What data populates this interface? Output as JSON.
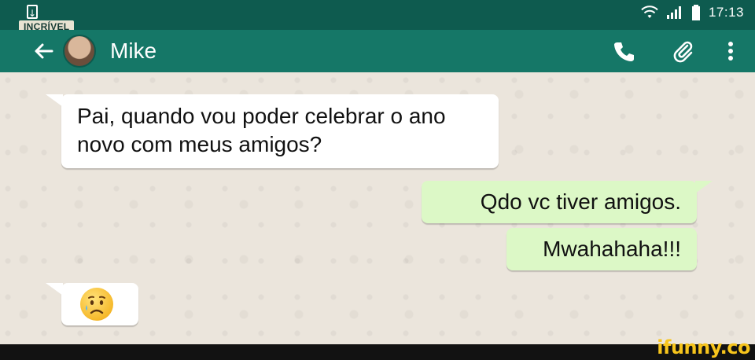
{
  "status_bar": {
    "time": "17:13",
    "brand_badge": "INCRÍVEL",
    "icons": [
      "download-icon",
      "wifi-icon",
      "signal-icon",
      "battery-icon"
    ]
  },
  "app_bar": {
    "contact_name": "Mike",
    "icons": [
      "back-arrow-icon",
      "avatar",
      "phone-icon",
      "paperclip-icon",
      "more-vert-icon"
    ]
  },
  "messages": [
    {
      "direction": "incoming",
      "text": "Pai, quando vou poder celebrar o ano novo com meus amigos?"
    },
    {
      "direction": "outgoing",
      "text": "Qdo vc tiver amigos."
    },
    {
      "direction": "outgoing",
      "text": "Mwahahaha!!!"
    },
    {
      "direction": "incoming",
      "text": "",
      "emoji": "sad-but-relieved-face-icon"
    }
  ],
  "watermark": "ifunny.co",
  "colors": {
    "status_bar": "#0e5b4f",
    "app_bar": "#157767",
    "chat_background": "#ebe5dc",
    "incoming_bubble": "#ffffff",
    "outgoing_bubble": "#dcf8c6",
    "watermark": "#f7c51c"
  }
}
